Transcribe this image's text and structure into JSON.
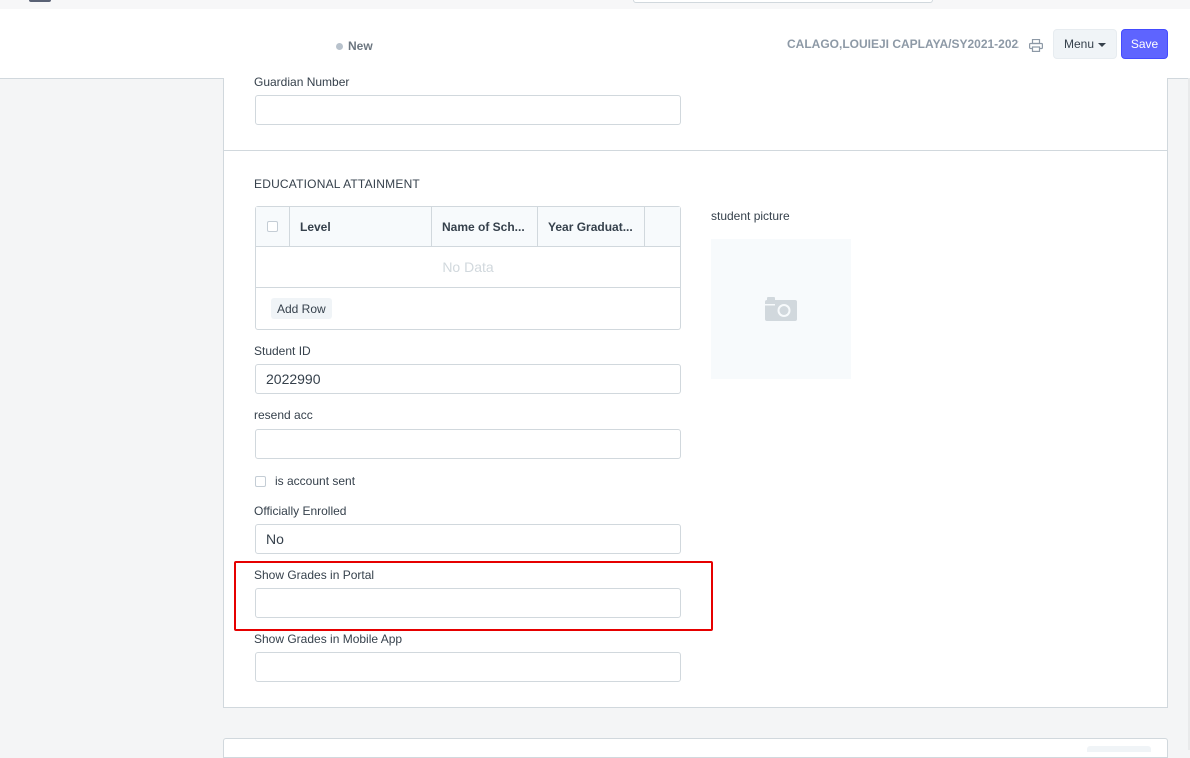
{
  "header": {
    "status": "New",
    "doc_title": "CALAGO,LOUIEJI CAPLAYA/SY2021-2022...",
    "menu_label": "Menu",
    "save_label": "Save"
  },
  "form": {
    "guardian_number": {
      "label": "Guardian Number",
      "value": ""
    },
    "education": {
      "section_title": "EDUCATIONAL ATTAINMENT",
      "columns": [
        "Level",
        "Name of Sch...",
        "Year Graduat..."
      ],
      "empty_text": "No Data",
      "add_row_label": "Add Row"
    },
    "student_picture_label": "student picture",
    "student_id": {
      "label": "Student ID",
      "value": "2022990"
    },
    "resend_acc": {
      "label": "resend acc",
      "value": ""
    },
    "is_account_sent": {
      "label": "is account sent",
      "checked": false
    },
    "officially_enrolled": {
      "label": "Officially Enrolled",
      "value": "No"
    },
    "show_grades_portal": {
      "label": "Show Grades in Portal",
      "value": ""
    },
    "show_grades_mobile": {
      "label": "Show Grades in Mobile App",
      "value": ""
    }
  },
  "colors": {
    "primary": "#5e64ff",
    "highlight": "#e60000",
    "border": "#d1d8dd"
  },
  "icons": [
    "printer-icon",
    "camera-icon",
    "caret-down-icon"
  ]
}
